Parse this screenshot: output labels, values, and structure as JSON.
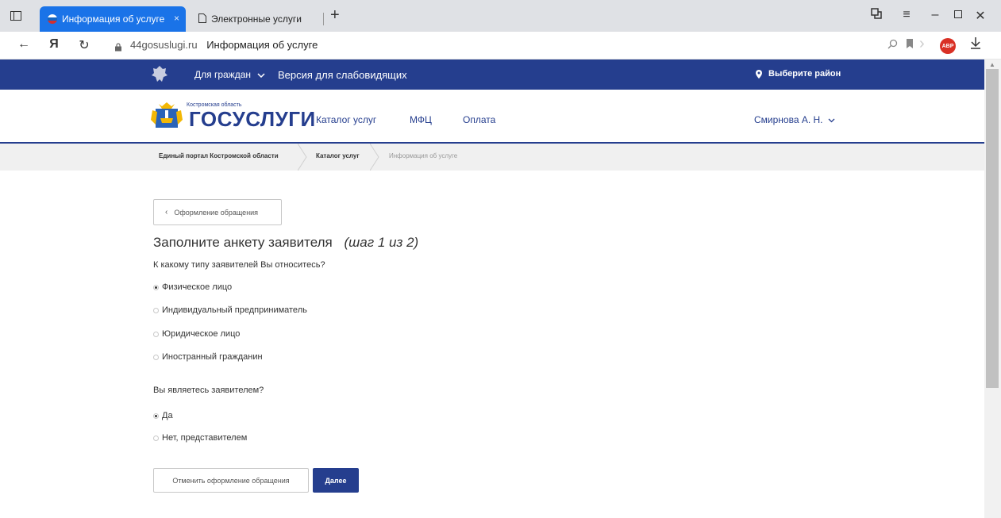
{
  "browser": {
    "tabs": [
      {
        "label": "Информация об услуге",
        "active": true,
        "close": "×"
      },
      {
        "label": "Электронные услуги",
        "active": false
      }
    ],
    "new_tab": "+",
    "address": {
      "domain": "44gosuslugi.ru",
      "title": "Информация об услуге"
    },
    "yandex_logo": "Я",
    "adblock_label": "ABP"
  },
  "site": {
    "top_nav": {
      "citizens": "Для граждан",
      "low_vision": "Версия для слабовидящих",
      "region": "Выберите район"
    },
    "logo": {
      "region_caption": "Костромская область",
      "brand_prefix": "ГОС",
      "brand_suffix": "УСЛУГИ"
    },
    "menu": [
      "Каталог услуг",
      "МФЦ",
      "Оплата"
    ],
    "user_name": "Смирнова А. Н.",
    "breadcrumbs": [
      "Единый портал Костромской области",
      "Каталог услуг",
      "Информация об услуге"
    ]
  },
  "form": {
    "back_label": "Оформление обращения",
    "title": "Заполните анкету заявителя",
    "step": "(шаг 1 из 2)",
    "q1": {
      "label": "К какому типу заявителей Вы относитесь?",
      "options": [
        "Физическое лицо",
        "Индивидуальный предприниматель",
        "Юридическое лицо",
        "Иностранный гражданин"
      ],
      "selected": "Физическое лицо"
    },
    "q2": {
      "label": "Вы являетесь заявителем?",
      "options": [
        "Да",
        "Нет, представителем"
      ],
      "selected": "Да"
    },
    "cancel_label": "Отменить оформление обращения",
    "next_label": "Далее"
  },
  "colors": {
    "brand": "#253e8e",
    "tab_active": "#1a73e8",
    "adblock": "#d93025"
  }
}
